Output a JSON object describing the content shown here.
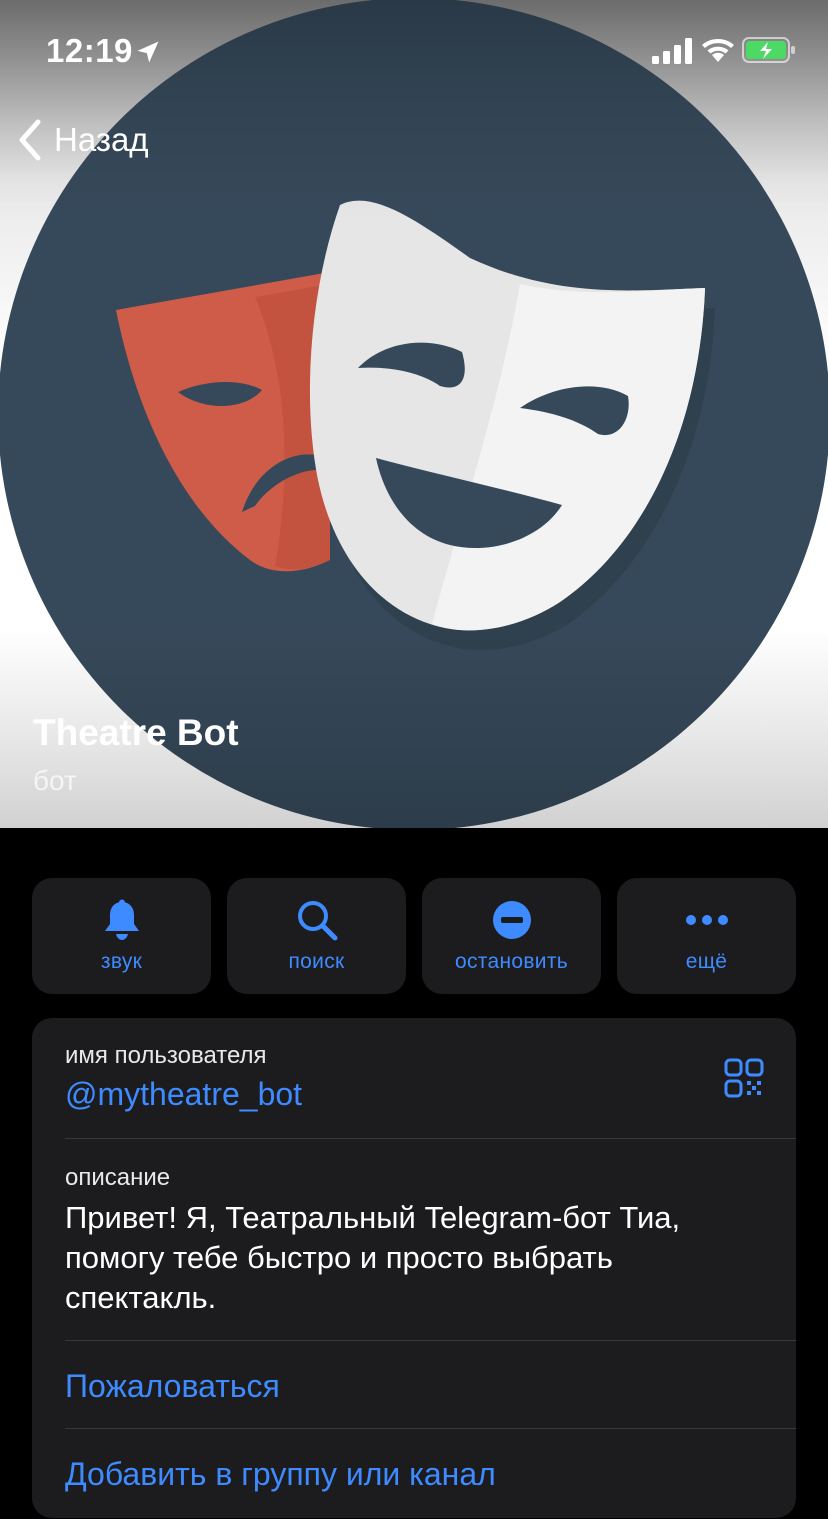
{
  "status_bar": {
    "time": "12:19",
    "icons": [
      "location-arrow-icon",
      "cellular-signal-icon",
      "wifi-icon",
      "battery-charging-icon"
    ]
  },
  "nav": {
    "back_label": "Назад",
    "back_icon": "chevron-left-icon"
  },
  "profile": {
    "name": "Theatre Bot",
    "subtitle": "бот",
    "avatar": "theatre-masks-avatar"
  },
  "actions": [
    {
      "label": "звук",
      "icon": "bell-icon"
    },
    {
      "label": "поиск",
      "icon": "search-icon"
    },
    {
      "label": "остановить",
      "icon": "stop-icon"
    },
    {
      "label": "ещё",
      "icon": "more-dots-icon"
    }
  ],
  "info": {
    "username_caption": "имя пользователя",
    "username": "@mytheatre_bot",
    "description_caption": "описание",
    "description": "Привет! Я, Театральный Telegram-бот Тиа, помогу тебе быстро и просто выбрать спектакль.",
    "report_label": "Пожаловаться",
    "add_to_group_label": "Добавить в группу или канал"
  },
  "colors": {
    "accent": "#3e8bff",
    "card_bg": "#1c1c1e",
    "page_bg": "#000000",
    "avatar_bg": "#36495a",
    "sad_mask": "#d0604c",
    "happy_mask": "#e9e9e9"
  }
}
